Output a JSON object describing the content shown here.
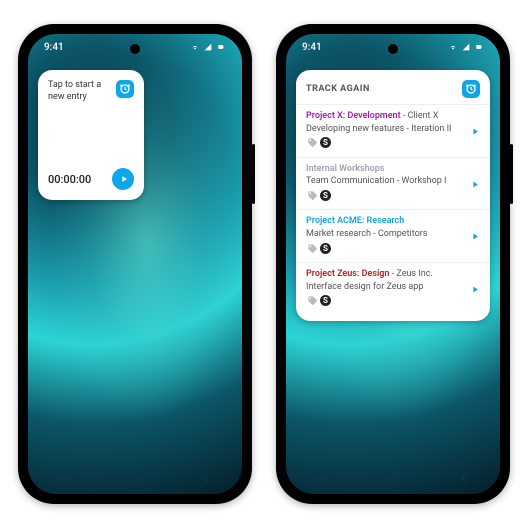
{
  "status": {
    "time": "9:41"
  },
  "small_widget": {
    "prompt": "Tap to start a new entry",
    "timer": "00:00:00"
  },
  "large_widget": {
    "title": "TRACK AGAIN",
    "entries": [
      {
        "project": "Project X: Development",
        "client": "Client X",
        "desc": "Developing new features - Iteration II",
        "color": "#a21caf"
      },
      {
        "project": "Internal Workshops",
        "client": "",
        "desc": "Team Communication - Workshop I",
        "color": "#9ca3af"
      },
      {
        "project": "Project ACME: Research",
        "client": "",
        "desc": "Market research - Competitors",
        "color": "#0ea5e9"
      },
      {
        "project": "Project Zeus: Design",
        "client": "Zeus Inc.",
        "desc": "Interface design for Zeus app",
        "color": "#b91c1c"
      }
    ]
  },
  "bill_symbol": "S"
}
